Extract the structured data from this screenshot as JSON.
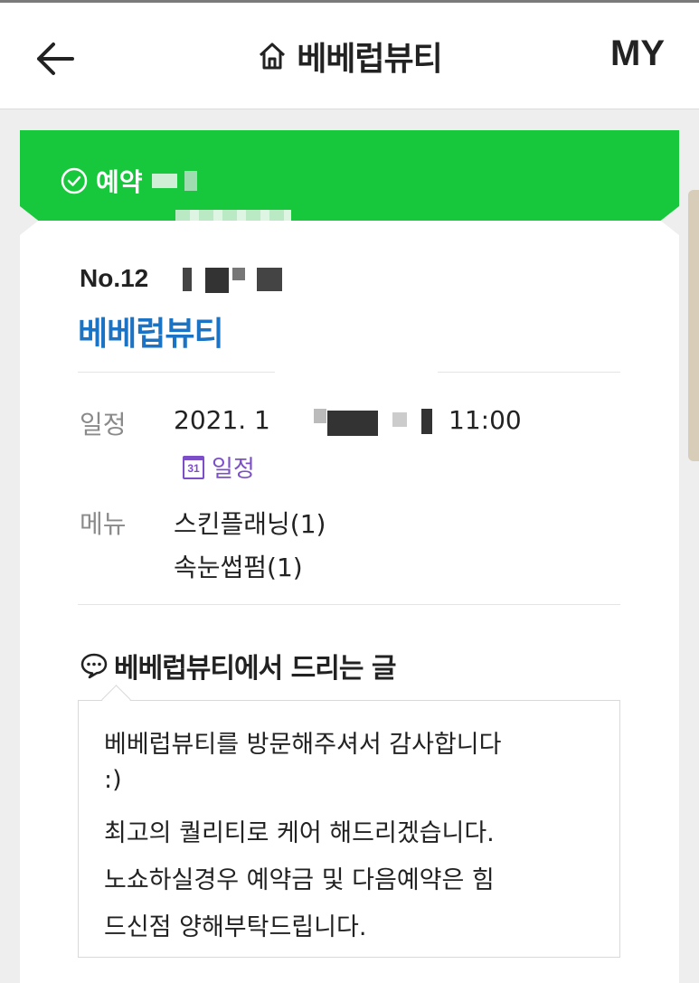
{
  "header": {
    "back_icon": "arrow-left-icon",
    "home_icon": "home-icon",
    "title": "베베럽뷰티",
    "my_label": "MY"
  },
  "banner": {
    "check_icon": "check-circle-icon",
    "status_text": "예약",
    "color": "#18c83c"
  },
  "reservation": {
    "number_visible": "No.12",
    "shop_name": "베베럽뷰티",
    "schedule_label": "일정",
    "date_visible": "2021. 1",
    "time": "11:00",
    "calendar_icon_text": "31",
    "calendar_link": "일정",
    "menu_label": "메뉴",
    "menu_items": [
      "스킨플래닝(1)",
      "속눈썹펌(1)"
    ]
  },
  "message": {
    "icon": "speech-bubble-icon",
    "title": "베베럽뷰티에서 드리는 글",
    "lines": [
      "베베럽뷰티를 방문해주셔서 감사합니다",
      ":)",
      "최고의 퀄리티로 케어 해드리겠습니다.",
      "노쇼하실경우 예약금 및 다음예약은 힘",
      "드신점 양해부탁드립니다."
    ]
  },
  "colors": {
    "accent_green": "#18c83c",
    "link_blue": "#1a73c4",
    "calendar_purple": "#7c4fc9"
  }
}
